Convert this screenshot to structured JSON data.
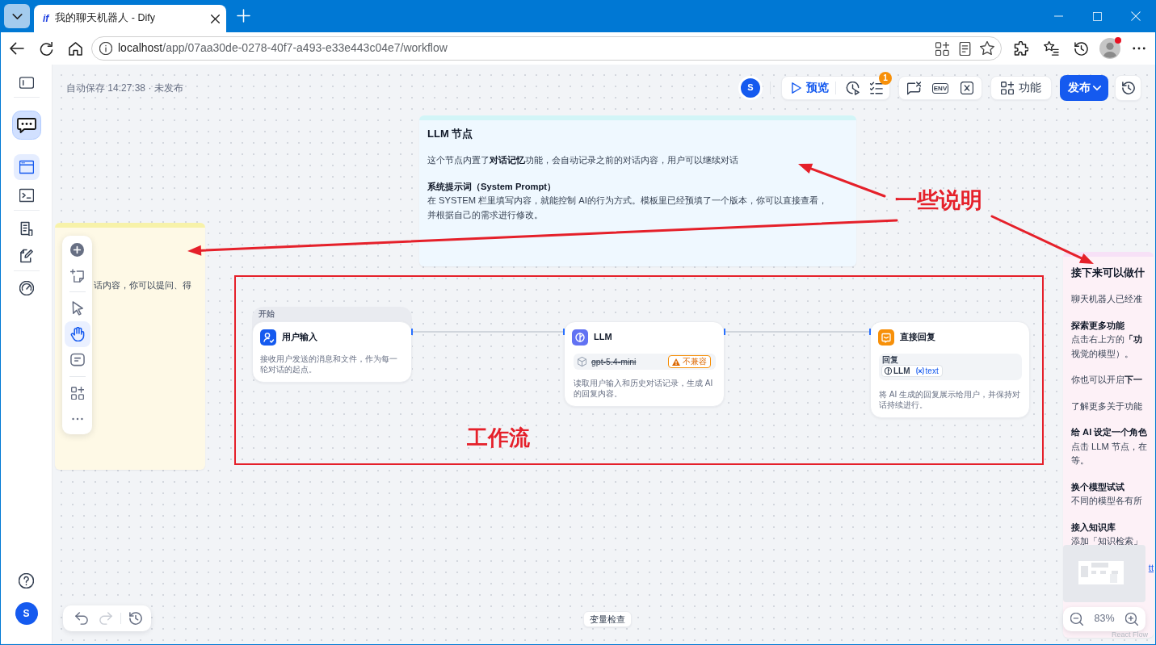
{
  "browser": {
    "tab": {
      "logo": "if",
      "title": "我的聊天机器人 - Dify"
    },
    "address": {
      "host": "localhost",
      "path": "/app/07aa30de-0278-40f7-a493-e33e443c04e7/workflow"
    },
    "profile_alert": true
  },
  "sidebar": {
    "nav": [
      {
        "selected": true
      },
      {
        "selected": false
      },
      {
        "selected": false
      },
      {
        "selected": false
      },
      {
        "selected": false
      }
    ],
    "user_initial": "S"
  },
  "header": {
    "save_status": "自动保存 14:27:38 · 未发布",
    "user_initial": "S",
    "preview": "预览",
    "checklist_count": "1",
    "env": "ENV",
    "features": "功能",
    "publish": "发布"
  },
  "notes": [
    {
      "color": "#fef9e6",
      "blocks": [
        {
          "kind": "text",
          "lines": [
            "话内容，你可以提问、得"
          ]
        }
      ]
    },
    {
      "color": "#eff8ff",
      "blocks": [
        {
          "kind": "title",
          "lines": [
            "LLM 节点"
          ]
        },
        {
          "kind": "text",
          "lines": [
            "这个节点内置了**对话记忆**功能，会自动记录之前的对话内容，用户可以继续对话"
          ]
        },
        {
          "kind": "subtitle",
          "lines": [
            "系统提示词（System Prompt）"
          ]
        },
        {
          "kind": "text",
          "lines": [
            "在 SYSTEM 栏里填写内容，就能控制 AI的行为方式。模板里已经预填了一个版本，你可以直接查看，",
            "并根据自己的需求进行修改。"
          ]
        }
      ]
    },
    {
      "color": "#fdf1f7",
      "blocks": [
        {
          "kind": "title",
          "lines": [
            "接下来可以做什"
          ]
        },
        {
          "kind": "text",
          "lines": [
            "聊天机器人已经准"
          ]
        },
        {
          "kind": "subtitle",
          "lines": [
            "探索更多功能"
          ]
        },
        {
          "kind": "text",
          "lines": [
            "点击右上方的**「功**",
            "视觉的模型）。"
          ]
        },
        {
          "kind": "text",
          "lines": [
            "你也可以开启**下一**"
          ]
        },
        {
          "kind": "text",
          "lines": [
            "了解更多关于功能"
          ]
        },
        {
          "kind": "subtitle",
          "lines": [
            "给 AI 设定一个角色"
          ]
        },
        {
          "kind": "text",
          "lines": [
            "点击 LLM 节点，在",
            "等。"
          ]
        },
        {
          "kind": "subtitle",
          "lines": [
            "换个模型试试"
          ]
        },
        {
          "kind": "text",
          "lines": [
            "不同的模型各有所"
          ]
        },
        {
          "kind": "subtitle",
          "lines": [
            "接入知识库"
          ]
        },
        {
          "kind": "text",
          "lines": [
            "添加「知识检索」"
          ]
        },
        {
          "kind": "link",
          "lines": [
            "tt"
          ]
        }
      ]
    }
  ],
  "tools": [
    {
      "selected": false
    },
    {
      "selected": true
    },
    {
      "selected": false
    }
  ],
  "workflow": {
    "nodes": [
      {
        "kind": "start",
        "group_label": "开始",
        "title": "用户输入",
        "description": "接收用户发送的消息和文件，作为每一轮对话的起点。"
      },
      {
        "kind": "llm",
        "title": "LLM",
        "model": {
          "name": "gpt-5.4-mini",
          "unavailable": true,
          "warning": "不兼容"
        },
        "description": "读取用户输入和历史对话记录，生成 AI 的回复内容。"
      },
      {
        "kind": "answer",
        "title": "直接回复",
        "field": {
          "label": "回复",
          "source": "LLM",
          "variable": "text"
        },
        "description": "将 AI 生成的回复展示给用户，并保持对话持续进行。"
      }
    ]
  },
  "annotations": {
    "labels": [
      "一些说明",
      "工作流"
    ]
  },
  "edit_history": [
    {
      "disabled": false
    },
    {
      "disabled": true
    }
  ],
  "footer": {
    "variable_inspect": "变量检查",
    "zoom": "83%",
    "attribution": "React Flow"
  }
}
